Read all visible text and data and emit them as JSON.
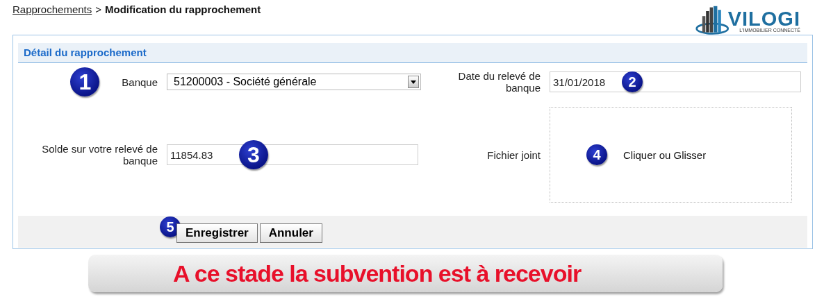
{
  "breadcrumb": {
    "link": "Rapprochements",
    "separator": ">",
    "current": "Modification du rapprochement"
  },
  "logo": {
    "name": "VILOGI",
    "tagline": "L'IMMOBILIER CONNECTÉ"
  },
  "panel": {
    "title": "Détail du rapprochement",
    "fields": [
      {
        "kind": "select",
        "label": "Banque",
        "value": "51200003 - Société générale",
        "label_marker": {
          "number": "1",
          "kind": "large"
        }
      },
      {
        "kind": "text",
        "label": "Date du relevé de banque",
        "value": "31/01/2018",
        "marker": {
          "number": "2",
          "kind": "small"
        }
      },
      {
        "kind": "text",
        "label": "Solde sur votre relevé de banque",
        "value": "11854.83",
        "marker": {
          "number": "3",
          "kind": "large"
        }
      },
      {
        "kind": "dropzone",
        "label": "Fichier joint",
        "value": "Cliquer ou Glisser",
        "marker": {
          "number": "4",
          "kind": "small"
        }
      }
    ],
    "footer": {
      "marker": {
        "number": "5",
        "kind": "small"
      },
      "buttons": [
        "Enregistrer",
        "Annuler"
      ]
    }
  },
  "banner": "A ce stade la subvention est à recevoir"
}
